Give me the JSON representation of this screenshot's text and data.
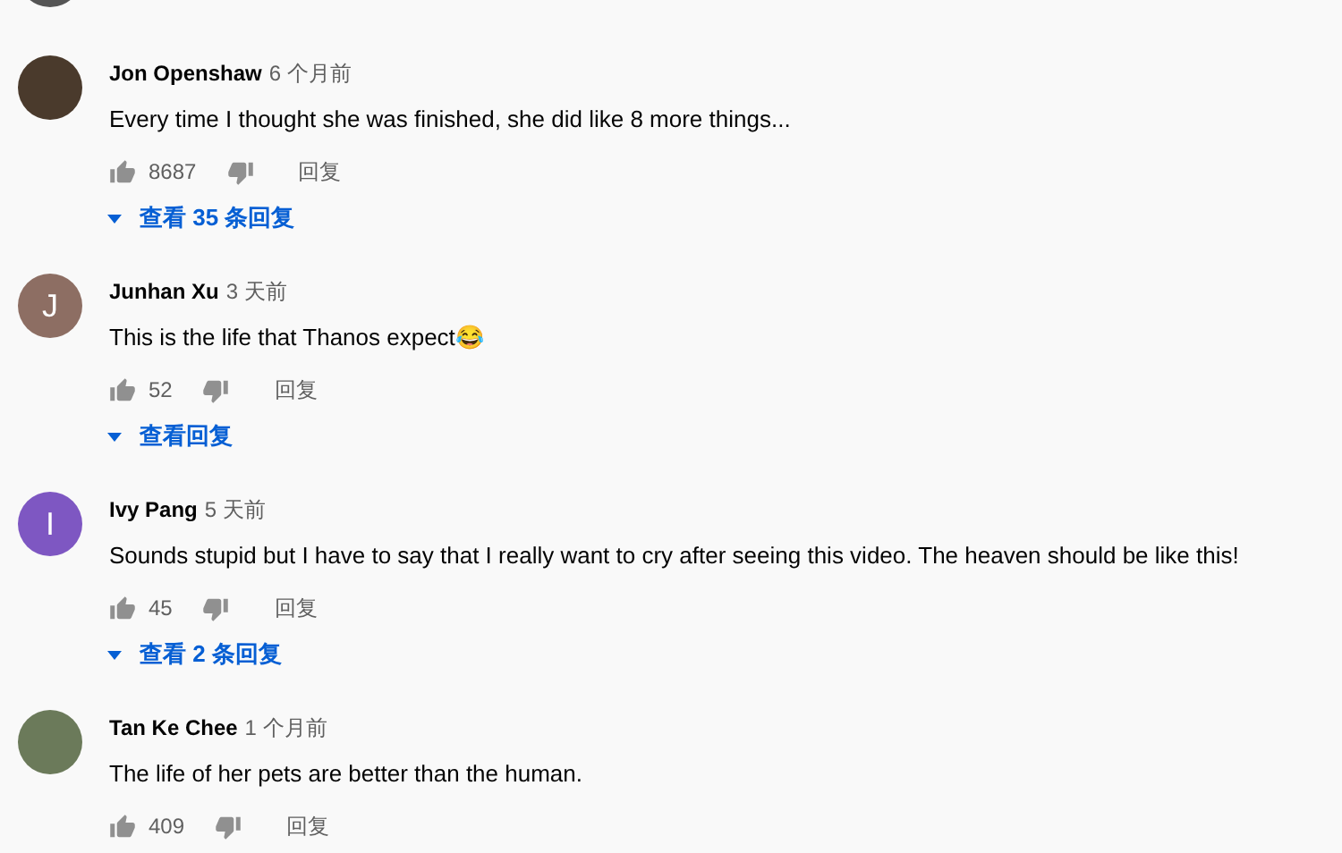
{
  "comments": [
    {
      "author": "Jon Openshaw",
      "time": "6 个月前",
      "text": "Every time I thought she was finished, she did like 8 more things...",
      "likes": "8687",
      "reply": "回复",
      "avatar": {
        "kind": "photo",
        "color": "#4a3a2c"
      },
      "replies": {
        "label": "查看 35 条回复"
      }
    },
    {
      "author": "Junhan Xu",
      "time": "3 天前",
      "text": "This is the life that Thanos expect😂",
      "likes": "52",
      "reply": "回复",
      "avatar": {
        "kind": "letter",
        "letter": "J",
        "color": "#8d6e63"
      },
      "replies": {
        "label": "查看回复"
      }
    },
    {
      "author": "Ivy Pang",
      "time": "5 天前",
      "text": "Sounds stupid but I have to say that I really want to cry after seeing this video. The heaven should be like this!",
      "likes": "45",
      "reply": "回复",
      "avatar": {
        "kind": "letter",
        "letter": "I",
        "color": "#7e57c2"
      },
      "replies": {
        "label": "查看 2 条回复"
      }
    },
    {
      "author": "Tan Ke Chee",
      "time": "1 个月前",
      "text": "The life of her pets are better than the human.",
      "likes": "409",
      "reply": "回复",
      "avatar": {
        "kind": "photo",
        "color": "#6b7a5a"
      }
    }
  ]
}
